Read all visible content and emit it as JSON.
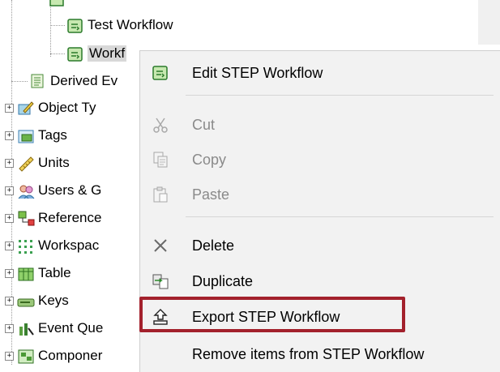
{
  "tree": {
    "items": [
      {
        "label": "Test Workflow"
      },
      {
        "label": "Workf"
      },
      {
        "label": "Derived Ev"
      },
      {
        "label": "Object Ty"
      },
      {
        "label": "Tags"
      },
      {
        "label": "Units"
      },
      {
        "label": "Users & G"
      },
      {
        "label": "Reference"
      },
      {
        "label": "Workspac"
      },
      {
        "label": "Table"
      },
      {
        "label": "Keys"
      },
      {
        "label": "Event Que"
      },
      {
        "label": "Componer"
      }
    ],
    "expander_symbol": "+"
  },
  "context_menu": {
    "items": [
      {
        "label": "Edit STEP Workflow",
        "icon": "workflow-icon",
        "enabled": true
      },
      {
        "label": "Cut",
        "icon": "scissors-icon",
        "enabled": false
      },
      {
        "label": "Copy",
        "icon": "copy-icon",
        "enabled": false
      },
      {
        "label": "Paste",
        "icon": "paste-icon",
        "enabled": false
      },
      {
        "label": "Delete",
        "icon": "delete-x-icon",
        "enabled": true
      },
      {
        "label": "Duplicate",
        "icon": "duplicate-icon",
        "enabled": true
      },
      {
        "label": "Export STEP Workflow",
        "icon": "export-icon",
        "enabled": true
      },
      {
        "label": "Remove items from STEP Workflow",
        "icon": "",
        "enabled": true
      }
    ],
    "highlight_color": "#a3212c"
  }
}
